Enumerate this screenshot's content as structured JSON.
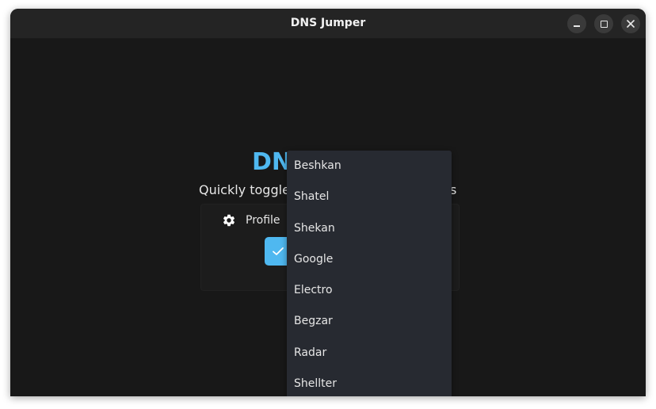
{
  "window": {
    "title": "DNS Jumper"
  },
  "main": {
    "app_title_partial": "DN",
    "subtitle_partial": "Quickly toggle",
    "subtitle_tail": "s",
    "profile_label": "Profile"
  },
  "dropdown": {
    "items": [
      {
        "label": "Beshkan"
      },
      {
        "label": "Shatel"
      },
      {
        "label": "Shekan"
      },
      {
        "label": "Google"
      },
      {
        "label": "Electro"
      },
      {
        "label": "Begzar"
      },
      {
        "label": "Radar"
      },
      {
        "label": "Shellter"
      }
    ]
  },
  "colors": {
    "accent": "#4fb8f0",
    "background": "#181818",
    "titlebar": "#242424",
    "dropdown_bg": "#272a31"
  },
  "icons": {
    "minimize": "minimize-icon",
    "maximize": "maximize-icon",
    "close": "close-icon",
    "gear": "gear-icon",
    "check": "check-icon"
  }
}
